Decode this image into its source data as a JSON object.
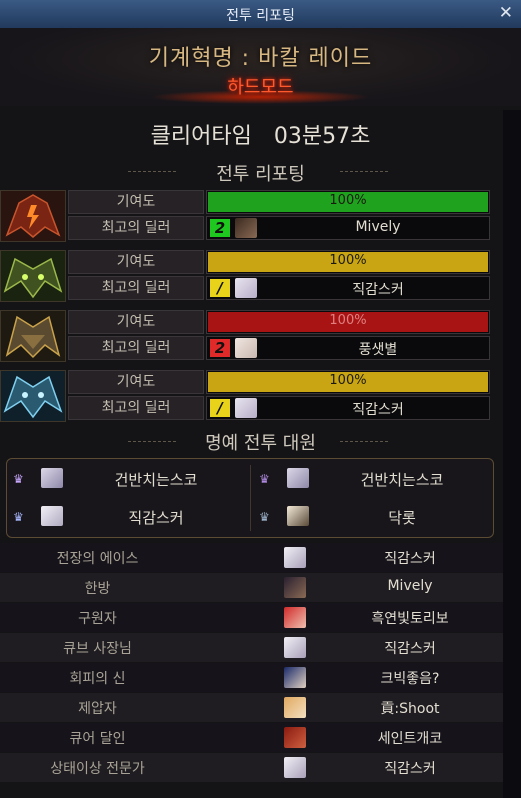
{
  "window": {
    "title": "전투 리포팅",
    "close": "✕"
  },
  "header": {
    "raid_name": "기계혁명 : 바칼 레이드",
    "mode": "하드모드"
  },
  "clear_time": {
    "label": "클리어타임",
    "value": "03분57초"
  },
  "report_section_title": "전투 리포팅",
  "honor_section_title": "명예 전투 대원",
  "colors": {
    "green_bar": "#1fa31f",
    "gold_bar": "#c9a514",
    "red_bar": "#a81414",
    "rank_green": "#1fc81f",
    "rank_yellow": "#e8d21a",
    "rank_red": "#e02a2a"
  },
  "bosses": [
    {
      "contrib_label": "기여도",
      "contrib_value": "100%",
      "contribution": 100,
      "bar_color": "green",
      "best_label": "최고의 딜러",
      "rank": "2",
      "rank_color": "green",
      "dealer": "Mively",
      "icon": "fire-dragon-boss-icon"
    },
    {
      "contrib_label": "기여도",
      "contrib_value": "100%",
      "contribution": 100,
      "bar_color": "gold",
      "best_label": "최고의 딜러",
      "rank": "/",
      "rank_color": "yellow",
      "dealer": "직감스커",
      "icon": "poison-dragon-boss-icon"
    },
    {
      "contrib_label": "기여도",
      "contrib_value": "100%",
      "contribution": 100,
      "bar_color": "red",
      "best_label": "최고의 딜러",
      "rank": "2",
      "rank_color": "red",
      "dealer": "풍샛별",
      "icon": "gold-dragon-boss-icon"
    },
    {
      "contrib_label": "기여도",
      "contrib_value": "100%",
      "contribution": 100,
      "bar_color": "gold",
      "best_label": "최고의 딜러",
      "rank": "/",
      "rank_color": "yellow",
      "dealer": "직감스커",
      "icon": "ice-dragon-boss-icon"
    }
  ],
  "honor_members": [
    {
      "name": "건반치는스코",
      "icon": "crown-icon"
    },
    {
      "name": "건반치는스코",
      "icon": "crown-icon"
    },
    {
      "name": "직감스커",
      "icon": "crown-icon"
    },
    {
      "name": "닥롯",
      "icon": "crown-icon"
    }
  ],
  "awards": [
    {
      "title": "전장의 에이스",
      "player": "직감스커"
    },
    {
      "title": "한방",
      "player": "Mively"
    },
    {
      "title": "구원자",
      "player": "흑연빛토리보"
    },
    {
      "title": "큐브 사장님",
      "player": "직감스커"
    },
    {
      "title": "회피의 신",
      "player": "크빅좋음?"
    },
    {
      "title": "제압자",
      "player": "貢:Shoot"
    },
    {
      "title": "큐어 달인",
      "player": "세인트개코"
    },
    {
      "title": "상태이상 전문가",
      "player": "직감스커"
    }
  ]
}
